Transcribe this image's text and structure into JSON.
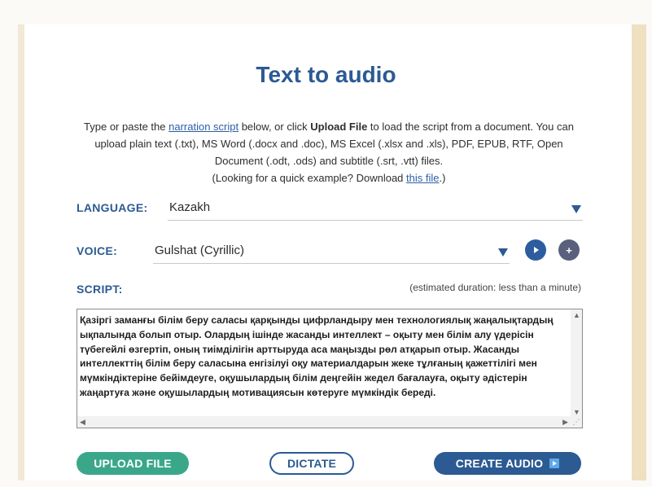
{
  "title": "Text to audio",
  "intro": {
    "t1": "Type or paste the ",
    "narration_link": "narration script",
    "t2": " below, or click ",
    "upload_file": "Upload File",
    "t3": " to load the script from a document. You can upload plain text (.txt), MS Word (.docx and .doc), MS Excel (.xlsx and .xls), PDF, EPUB, RTF, Open Document (.odt, .ods) and subtitle (.srt, .vtt) files.",
    "t4": "(Looking for a quick example? Download ",
    "example_link": "this file",
    "t5": ".)"
  },
  "language": {
    "label": "LANGUAGE:",
    "value": "Kazakh"
  },
  "voice": {
    "label": "VOICE:",
    "value": "Gulshat (Cyrillic)"
  },
  "script": {
    "label": "SCRIPT:",
    "estimate": "(estimated duration: less than a minute)",
    "text": "Қазіргі заманғы білім беру саласы қарқынды цифрландыру мен технологиялық жаңалықтардың ықпалында болып отыр. Олардың ішінде жасанды интеллект – оқыту мен білім алу үдерісін түбегейлі өзгертіп, оның тиімділігін арттыруда аса маңызды рөл атқарып отыр. Жасанды интеллекттің білім беру саласына енгізілуі оқу материалдарын жеке тұлғаның қажеттілігі мен мүмкіндіктеріне бейімдеуге, оқушылардың білім деңгейін жедел бағалауға, оқыту әдістерін жаңартуға және оқушылардың мотивациясын көтеруге мүмкіндік береді."
  },
  "buttons": {
    "upload": "UPLOAD FILE",
    "dictate": "DICTATE",
    "create": "CREATE AUDIO"
  },
  "icons": {
    "play": "play-icon",
    "add": "add-icon",
    "caret": "chevron-down-icon"
  },
  "colors": {
    "primary": "#2c5a93",
    "upload_green": "#3aa78a",
    "accent_blue": "#5da9e9"
  }
}
